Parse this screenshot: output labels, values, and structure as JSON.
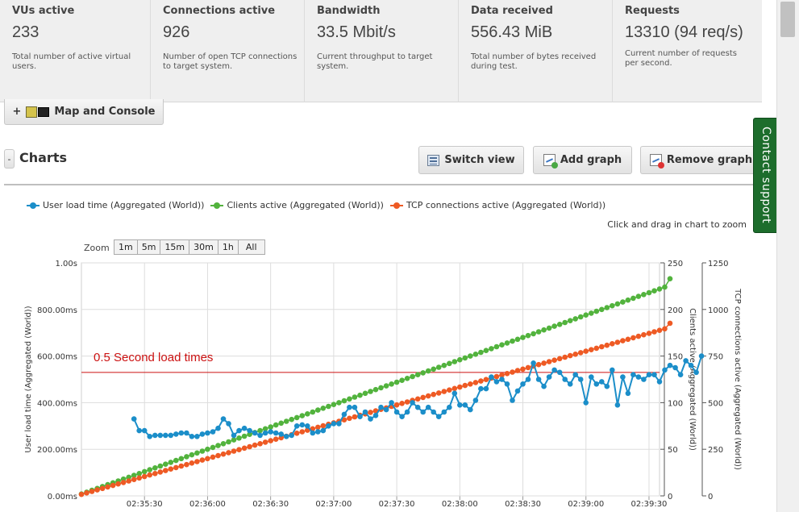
{
  "stats": [
    {
      "label": "VUs active",
      "value": "233",
      "desc": "Total number of active virtual users."
    },
    {
      "label": "Connections active",
      "value": "926",
      "desc": "Number of open TCP connections to target system."
    },
    {
      "label": "Bandwidth",
      "value": "33.5 Mbit/s",
      "desc": "Current throughput to target system."
    },
    {
      "label": "Data received",
      "value": "556.43 MiB",
      "desc": "Total number of bytes received during test."
    },
    {
      "label": "Requests",
      "value": "13310 (94 req/s)",
      "desc": "Current number of requests per second."
    }
  ],
  "map_console": {
    "prefix": "+",
    "label": "Map and Console",
    "icon": "map-console-icon"
  },
  "charts": {
    "toggle": "-",
    "title": "Charts"
  },
  "toolbar": {
    "switch_view": "Switch view",
    "add_graph": "Add graph",
    "remove_graph": "Remove graph"
  },
  "contact_support": "Contact support",
  "chart": {
    "legend": [
      {
        "name": "User load time (Aggregated (World))",
        "color": "#1b8ec9"
      },
      {
        "name": "Clients active (Aggregated (World))",
        "color": "#52b33d"
      },
      {
        "name": "TCP connections active (Aggregated (World))",
        "color": "#ee5a24"
      }
    ],
    "zoom_hint": "Click and drag in chart to zoom",
    "zoom_label": "Zoom",
    "zoom_buttons": [
      "1m",
      "5m",
      "15m",
      "30m",
      "1h",
      "All"
    ],
    "annotation": "0.5 Second load times",
    "annotation_color": "#cc1111"
  },
  "chart_data": {
    "type": "line",
    "x_unit": "time",
    "x_ticks": [
      "02:35:30",
      "02:36:00",
      "02:36:30",
      "02:37:00",
      "02:37:30",
      "02:38:00",
      "02:38:30",
      "02:39:00",
      "02:39:30"
    ],
    "y_left": {
      "label": "User load time (Aggregated (World))",
      "ticks": [
        "0.00ms",
        "200.00ms",
        "400.00ms",
        "600.00ms",
        "800.00ms",
        "1.00s"
      ],
      "range": [
        0,
        1000
      ]
    },
    "y_right1": {
      "label": "Clients active (Aggregated (World))",
      "ticks": [
        "0",
        "50",
        "100",
        "150",
        "200",
        "250"
      ],
      "range": [
        0,
        250
      ]
    },
    "y_right2": {
      "label": "TCP connections active (Aggregated (World))",
      "ticks": [
        "0",
        "250",
        "500",
        "750",
        "1000",
        "1250"
      ],
      "range": [
        0,
        1250
      ]
    },
    "reference_line": {
      "axis": "left",
      "value": 530
    },
    "x_range_seconds": [
      0,
      275
    ],
    "series": [
      {
        "name": "User load time (Aggregated (World))",
        "axis": "left",
        "x_start": 25,
        "x_step": 2.5,
        "values": [
          330,
          280,
          280,
          255,
          260,
          260,
          260,
          260,
          265,
          270,
          270,
          255,
          255,
          265,
          270,
          275,
          290,
          330,
          310,
          260,
          280,
          290,
          280,
          270,
          260,
          270,
          275,
          270,
          265,
          255,
          260,
          300,
          305,
          300,
          270,
          275,
          280,
          300,
          310,
          310,
          350,
          380,
          380,
          340,
          360,
          330,
          345,
          380,
          370,
          400,
          360,
          340,
          360,
          400,
          380,
          360,
          380,
          360,
          340,
          360,
          380,
          440,
          390,
          390,
          370,
          410,
          460,
          460,
          510,
          490,
          500,
          480,
          410,
          450,
          480,
          500,
          570,
          500,
          470,
          510,
          540,
          530,
          500,
          480,
          520,
          500,
          400,
          510,
          480,
          490,
          470,
          540,
          390,
          510,
          440,
          520,
          510,
          500,
          520,
          520,
          490,
          540,
          560,
          550,
          520,
          580,
          560,
          530,
          600
        ]
      },
      {
        "name": "Clients active (Aggregated (World))",
        "axis": "right1",
        "x_start": 0,
        "x_step": 2.5,
        "values": [
          2,
          4,
          6,
          8,
          10,
          12,
          14,
          16,
          18,
          20,
          22,
          24,
          26,
          28,
          30,
          32,
          34,
          36,
          38,
          40,
          42,
          44,
          46,
          48,
          50,
          52,
          54,
          56,
          58,
          60,
          62,
          64,
          66,
          68,
          70,
          72,
          74,
          76,
          78,
          80,
          82,
          84,
          86,
          88,
          90,
          92,
          94,
          96,
          98,
          100,
          102,
          104,
          106,
          108,
          110,
          112,
          114,
          116,
          118,
          120,
          122,
          124,
          126,
          128,
          130,
          132,
          134,
          136,
          138,
          140,
          142,
          144,
          146,
          148,
          150,
          152,
          154,
          156,
          158,
          160,
          162,
          164,
          166,
          168,
          170,
          172,
          174,
          176,
          178,
          180,
          182,
          184,
          186,
          188,
          190,
          192,
          194,
          196,
          198,
          200,
          202,
          204,
          206,
          208,
          210,
          212,
          214,
          216,
          218,
          220,
          222,
          224,
          233
        ]
      },
      {
        "name": "TCP connections active (Aggregated (World))",
        "axis": "right2",
        "x_start": 0,
        "x_step": 2.5,
        "values": [
          8,
          16,
          24,
          32,
          40,
          48,
          56,
          64,
          72,
          80,
          88,
          96,
          104,
          112,
          120,
          128,
          136,
          144,
          152,
          160,
          168,
          176,
          184,
          192,
          200,
          208,
          216,
          224,
          232,
          240,
          248,
          256,
          264,
          272,
          280,
          288,
          296,
          304,
          312,
          320,
          328,
          336,
          344,
          352,
          360,
          368,
          376,
          384,
          392,
          400,
          408,
          416,
          424,
          432,
          440,
          448,
          456,
          464,
          472,
          480,
          488,
          496,
          504,
          512,
          520,
          528,
          536,
          544,
          552,
          560,
          568,
          576,
          584,
          592,
          600,
          608,
          616,
          624,
          632,
          640,
          648,
          656,
          664,
          672,
          680,
          688,
          696,
          704,
          712,
          720,
          728,
          736,
          744,
          752,
          760,
          768,
          776,
          784,
          792,
          800,
          808,
          816,
          824,
          832,
          840,
          848,
          856,
          864,
          872,
          880,
          888,
          896,
          926
        ]
      }
    ]
  }
}
